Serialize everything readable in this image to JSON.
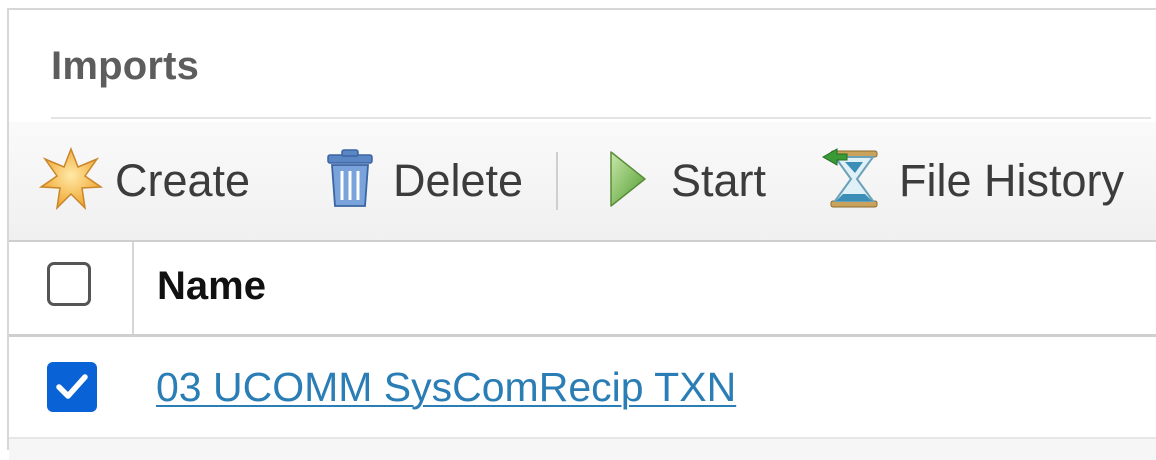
{
  "panel": {
    "title": "Imports"
  },
  "toolbar": {
    "create": {
      "label": "Create",
      "icon": "star-icon"
    },
    "delete": {
      "label": "Delete",
      "icon": "trash-icon"
    },
    "start": {
      "label": "Start",
      "icon": "play-icon"
    },
    "file_history": {
      "label": "File History",
      "icon": "hourglass-icon"
    }
  },
  "grid": {
    "columns": [
      {
        "label": "Name"
      }
    ],
    "rows": [
      {
        "name": "03 UCOMM SysComRecip TXN",
        "checked": true
      }
    ]
  },
  "colors": {
    "link": "#2a7db5",
    "checkbox_checked": "#0a63d6",
    "title": "#5d5d5d"
  }
}
